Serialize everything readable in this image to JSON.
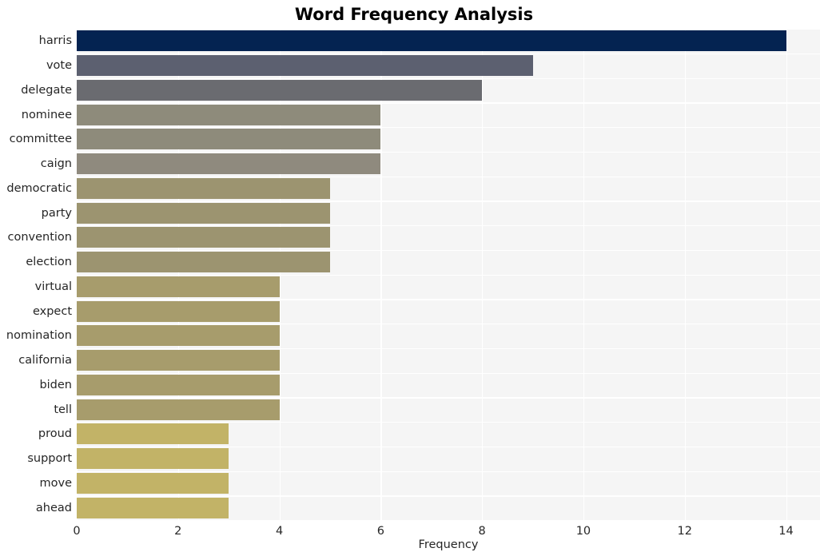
{
  "chart_data": {
    "type": "bar",
    "orientation": "horizontal",
    "title": "Word Frequency Analysis",
    "xlabel": "Frequency",
    "ylabel": "",
    "categories": [
      "harris",
      "vote",
      "delegate",
      "nominee",
      "committee",
      "caign",
      "democratic",
      "party",
      "convention",
      "election",
      "virtual",
      "expect",
      "nomination",
      "california",
      "biden",
      "tell",
      "proud",
      "support",
      "move",
      "ahead"
    ],
    "values": [
      14,
      9,
      8,
      6,
      6,
      6,
      5,
      5,
      5,
      5,
      4,
      4,
      4,
      4,
      4,
      4,
      3,
      3,
      3,
      3
    ],
    "bar_colors": [
      "#042351",
      "#5c6070",
      "#6a6b70",
      "#8e8b7b",
      "#8e8b7b",
      "#8f8a7e",
      "#9c9470",
      "#9c9470",
      "#9c9470",
      "#9c9470",
      "#a79c6c",
      "#a79c6c",
      "#a79c6c",
      "#a79c6c",
      "#a79c6c",
      "#a79c6c",
      "#c2b367",
      "#c2b367",
      "#c2b367",
      "#c2b367"
    ],
    "xticks": [
      0,
      2,
      4,
      6,
      8,
      10,
      12,
      14
    ],
    "xtick_labels": [
      "0",
      "2",
      "4",
      "6",
      "8",
      "10",
      "12",
      "14"
    ],
    "xlim": [
      0,
      14.67
    ],
    "grid": true,
    "grid_color": "#ffffff",
    "plot_background": "#f5f5f5",
    "figure_background": "#ffffff",
    "legend": null
  }
}
